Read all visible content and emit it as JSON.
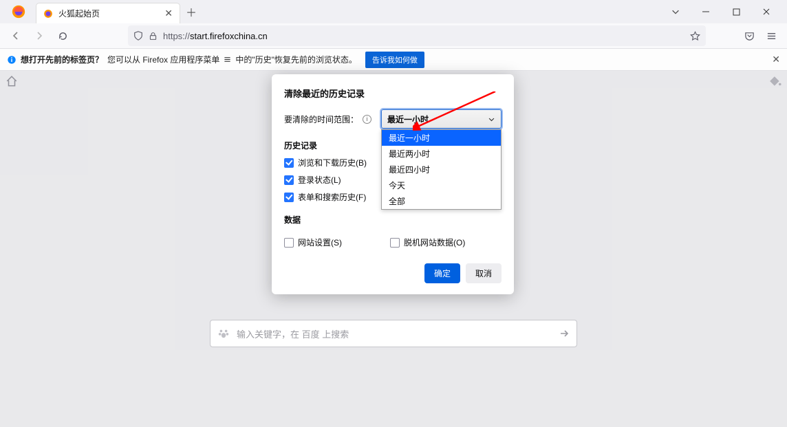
{
  "tab": {
    "title": "火狐起始页"
  },
  "url": {
    "scheme": "https://",
    "host": "start.firefoxchina.cn"
  },
  "infobar": {
    "strong": "想打开先前的标签页？",
    "text1": "您可以从 Firefox 应用程序菜单 ",
    "text2": " 中的\"历史\"恢复先前的浏览状态。",
    "button": "告诉我如何做"
  },
  "search": {
    "placeholder": "输入关键字，在 百度 上搜索"
  },
  "dialog": {
    "title": "清除最近的历史记录",
    "range_label": "要清除的时间范围：",
    "select_value": "最近一小时",
    "options": [
      "最近一小时",
      "最近两小时",
      "最近四小时",
      "今天",
      "全部"
    ],
    "section_history": "历史记录",
    "chk_browsing": "浏览和下载历史(B)",
    "chk_login": "登录状态(L)",
    "chk_forms": "表单和搜索历史(F)",
    "section_data": "数据",
    "chk_site": "网站设置(S)",
    "chk_offline": "脱机网站数据(O)",
    "ok": "确定",
    "cancel": "取消"
  }
}
